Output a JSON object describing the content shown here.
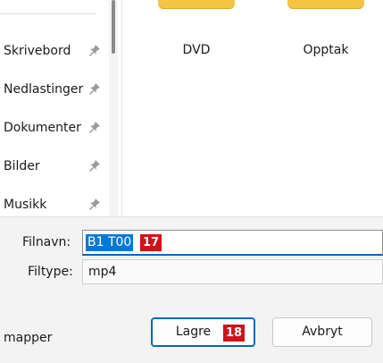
{
  "nav": {
    "items": [
      {
        "label": "Skrivebord",
        "icon": "pin-icon"
      },
      {
        "label": "Nedlastinger",
        "icon": "pin-icon"
      },
      {
        "label": "Dokumenter",
        "icon": "pin-icon"
      },
      {
        "label": "Bilder",
        "icon": "pin-icon"
      },
      {
        "label": "Musikk",
        "icon": "pin-icon"
      }
    ]
  },
  "folders": [
    {
      "name": "DVD",
      "icon": "folder-icon"
    },
    {
      "name": "Opptak",
      "icon": "folder-icon"
    }
  ],
  "form": {
    "filename_label": "Filnavn:",
    "filename_value": "B1 T00",
    "filename_badge": "17",
    "filetype_label": "Filtype:",
    "filetype_value": "mp4"
  },
  "footer": {
    "hide_folders_label": "mapper",
    "save_label": "Lagre",
    "save_badge": "18",
    "cancel_label": "Avbryt"
  },
  "colors": {
    "accent": "#0067c0",
    "selection": "#0078d4",
    "badge": "#d0121b",
    "folder": "#f5c542"
  }
}
